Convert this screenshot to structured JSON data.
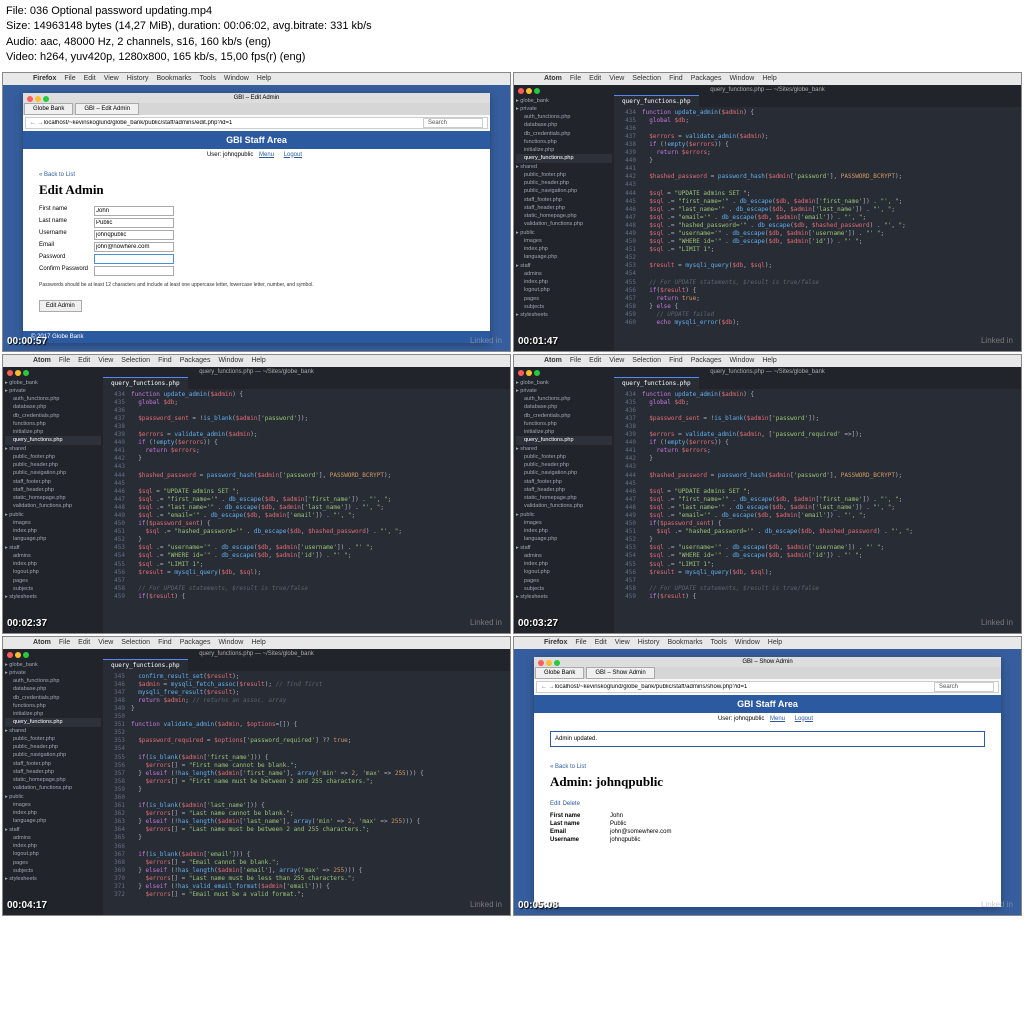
{
  "meta": {
    "file": "File: 036 Optional password updating.mp4",
    "size": "Size: 14963148 bytes (14,27 MiB), duration: 00:06:02, avg.bitrate: 331 kb/s",
    "audio": "Audio: aac, 48000 Hz, 2 channels, s16, 160 kb/s (eng)",
    "video": "Video: h264, yuv420p, 1280x800, 165 kb/s, 15,00 fps(r) (eng)"
  },
  "mac_firefox": [
    "Firefox",
    "File",
    "Edit",
    "View",
    "History",
    "Bookmarks",
    "Tools",
    "Window",
    "Help"
  ],
  "mac_atom": [
    "Atom",
    "File",
    "Edit",
    "View",
    "Selection",
    "Find",
    "Packages",
    "Window",
    "Help"
  ],
  "timestamps": [
    "00:00:57",
    "00:01:47",
    "00:02:37",
    "00:03:27",
    "00:04:17",
    "00:05:08"
  ],
  "linkedin": "Linked in",
  "cell1": {
    "title": "GBI – Edit Admin",
    "tab1": "Globe Bank",
    "tab2": "GBI – Edit Admin",
    "url": "localhost/~kevinskoglund/globe_bank/public/staff/admins/edit.php?id=1",
    "search": "Search",
    "hdr": "GBI Staff Area",
    "user": "User: johnqpublic",
    "menu": "Menu",
    "logout": "Logout",
    "back": "« Back to List",
    "h1": "Edit Admin",
    "fields": {
      "fn": "First name",
      "fn_v": "John",
      "ln": "Last name",
      "ln_v": "Public",
      "un": "Username",
      "un_v": "johnqpublic",
      "em": "Email",
      "em_v": "john@nowhere.com",
      "pw": "Password",
      "cp": "Confirm Password"
    },
    "note": "Passwords should be at least 12 characters and include at least one uppercase letter, lowercase letter, number, and symbol.",
    "btn": "Edit Admin",
    "footer": "© 2017 Globe Bank"
  },
  "atom": {
    "title": "query_functions.php — ~/Sites/globe_bank",
    "tab": "query_functions.php",
    "tree": [
      "globe_bank",
      "private",
      "auth_functions.php",
      "database.php",
      "db_credentials.php",
      "functions.php",
      "initialize.php",
      "query_functions.php",
      "shared",
      "public_footer.php",
      "public_header.php",
      "public_navigation.php",
      "staff_footer.php",
      "staff_header.php",
      "static_homepage.php",
      "validation_functions.php",
      "public",
      "images",
      "index.php",
      "language.php",
      "staff",
      "admins",
      "index.php",
      "logout.php",
      "pages",
      "subjects",
      "stylesheets"
    ]
  },
  "cell6": {
    "title": "GBI – Show Admin",
    "tab2": "GBI – Show Admin",
    "url": "localhost/~kevinskoglund/globe_bank/public/staff/admins/show.php?id=1",
    "alert": "Admin updated.",
    "h1": "Admin: johnqpublic",
    "edit": "Edit",
    "del": "Delete",
    "rows": [
      [
        "First name",
        "John"
      ],
      [
        "Last name",
        "Public"
      ],
      [
        "Email",
        "john@somewhere.com"
      ],
      [
        "Username",
        "johnqpublic"
      ]
    ]
  }
}
